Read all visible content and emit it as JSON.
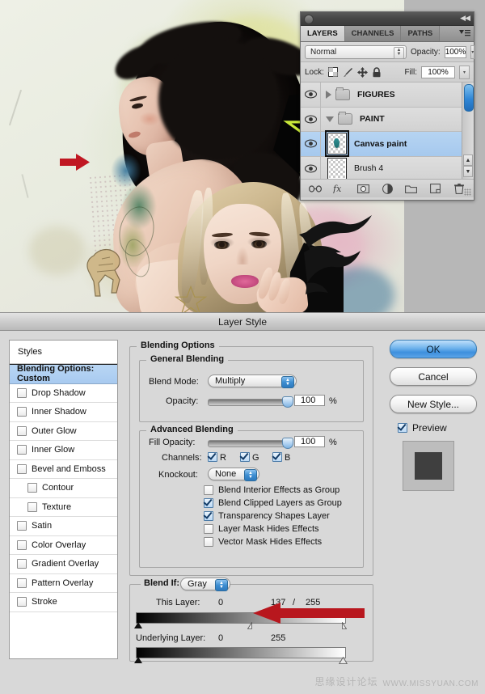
{
  "artwork": {
    "name": "photo-collage-artwork",
    "annotation_arrow_color": "#c01722",
    "description_elements": [
      "brunette-model",
      "blonde-model",
      "lime-star",
      "black-polygon",
      "eye-ellipse",
      "ink-birds",
      "horse-sketch",
      "teal-paint-blob"
    ]
  },
  "layers_panel": {
    "tabs": [
      {
        "label": "LAYERS",
        "active": true
      },
      {
        "label": "CHANNELS",
        "active": false
      },
      {
        "label": "PATHS",
        "active": false
      }
    ],
    "blend_mode": "Normal",
    "opacity_label": "Opacity:",
    "opacity_value": "100%",
    "lock_label": "Lock:",
    "fill_label": "Fill:",
    "fill_value": "100%",
    "lock_icons": [
      "transparency-lock-icon",
      "brush-lock-icon",
      "move-lock-icon",
      "lock-all-icon"
    ],
    "layers": [
      {
        "name": "FIGURES",
        "type": "group",
        "expanded": false,
        "visible": true,
        "selected": false
      },
      {
        "name": "PAINT",
        "type": "group",
        "expanded": true,
        "visible": true,
        "selected": false
      },
      {
        "name": "Canvas paint",
        "type": "layer",
        "visible": true,
        "selected": true
      },
      {
        "name": "Brush 4",
        "type": "layer",
        "visible": true,
        "selected": false
      }
    ],
    "footer_icons": [
      "link-icon",
      "fx-icon",
      "add-mask-icon",
      "adjustment-layer-icon",
      "new-group-icon",
      "new-layer-icon",
      "delete-layer-icon"
    ]
  },
  "dialog": {
    "title": "Layer Style",
    "styles": {
      "header": "Styles",
      "items": [
        {
          "label": "Blending Options: Custom",
          "checkbox": false,
          "active": true,
          "indent": false
        },
        {
          "label": "Drop Shadow",
          "checkbox": true,
          "checked": false,
          "indent": false
        },
        {
          "label": "Inner Shadow",
          "checkbox": true,
          "checked": false,
          "indent": false
        },
        {
          "label": "Outer Glow",
          "checkbox": true,
          "checked": false,
          "indent": false
        },
        {
          "label": "Inner Glow",
          "checkbox": true,
          "checked": false,
          "indent": false
        },
        {
          "label": "Bevel and Emboss",
          "checkbox": true,
          "checked": false,
          "indent": false
        },
        {
          "label": "Contour",
          "checkbox": true,
          "checked": false,
          "indent": true
        },
        {
          "label": "Texture",
          "checkbox": true,
          "checked": false,
          "indent": true
        },
        {
          "label": "Satin",
          "checkbox": true,
          "checked": false,
          "indent": false
        },
        {
          "label": "Color Overlay",
          "checkbox": true,
          "checked": false,
          "indent": false
        },
        {
          "label": "Gradient Overlay",
          "checkbox": true,
          "checked": false,
          "indent": false
        },
        {
          "label": "Pattern Overlay",
          "checkbox": true,
          "checked": false,
          "indent": false
        },
        {
          "label": "Stroke",
          "checkbox": true,
          "checked": false,
          "indent": false
        }
      ]
    },
    "blending_options": {
      "legend": "Blending Options",
      "general": {
        "legend": "General Blending",
        "blend_mode_label": "Blend Mode:",
        "blend_mode_value": "Multiply",
        "opacity_label": "Opacity:",
        "opacity_value": "100",
        "opacity_unit": "%"
      },
      "advanced": {
        "legend": "Advanced Blending",
        "fill_opacity_label": "Fill Opacity:",
        "fill_opacity_value": "100",
        "fill_opacity_unit": "%",
        "channels_label": "Channels:",
        "channels": [
          {
            "label": "R",
            "checked": true
          },
          {
            "label": "G",
            "checked": true
          },
          {
            "label": "B",
            "checked": true
          }
        ],
        "knockout_label": "Knockout:",
        "knockout_value": "None",
        "checkboxes": [
          {
            "label": "Blend Interior Effects as Group",
            "checked": false
          },
          {
            "label": "Blend Clipped Layers as Group",
            "checked": true
          },
          {
            "label": "Transparency Shapes Layer",
            "checked": true
          },
          {
            "label": "Layer Mask Hides Effects",
            "checked": false
          },
          {
            "label": "Vector Mask Hides Effects",
            "checked": false
          }
        ]
      },
      "blend_if": {
        "legend": "Blend If:",
        "channel_value": "Gray",
        "this_layer": {
          "label": "This Layer:",
          "black_value": "0",
          "white_low_value": "137",
          "separator": "/",
          "white_high_value": "255"
        },
        "underlying_layer": {
          "label": "Underlying Layer:",
          "black_value": "0",
          "white_value": "255"
        }
      }
    },
    "buttons": {
      "ok": "OK",
      "cancel": "Cancel",
      "new_style": "New Style...",
      "preview_label": "Preview",
      "preview_checked": true
    }
  },
  "watermark": {
    "chinese": "思缘设计论坛",
    "english": "WWW.MISSYUAN.COM"
  }
}
